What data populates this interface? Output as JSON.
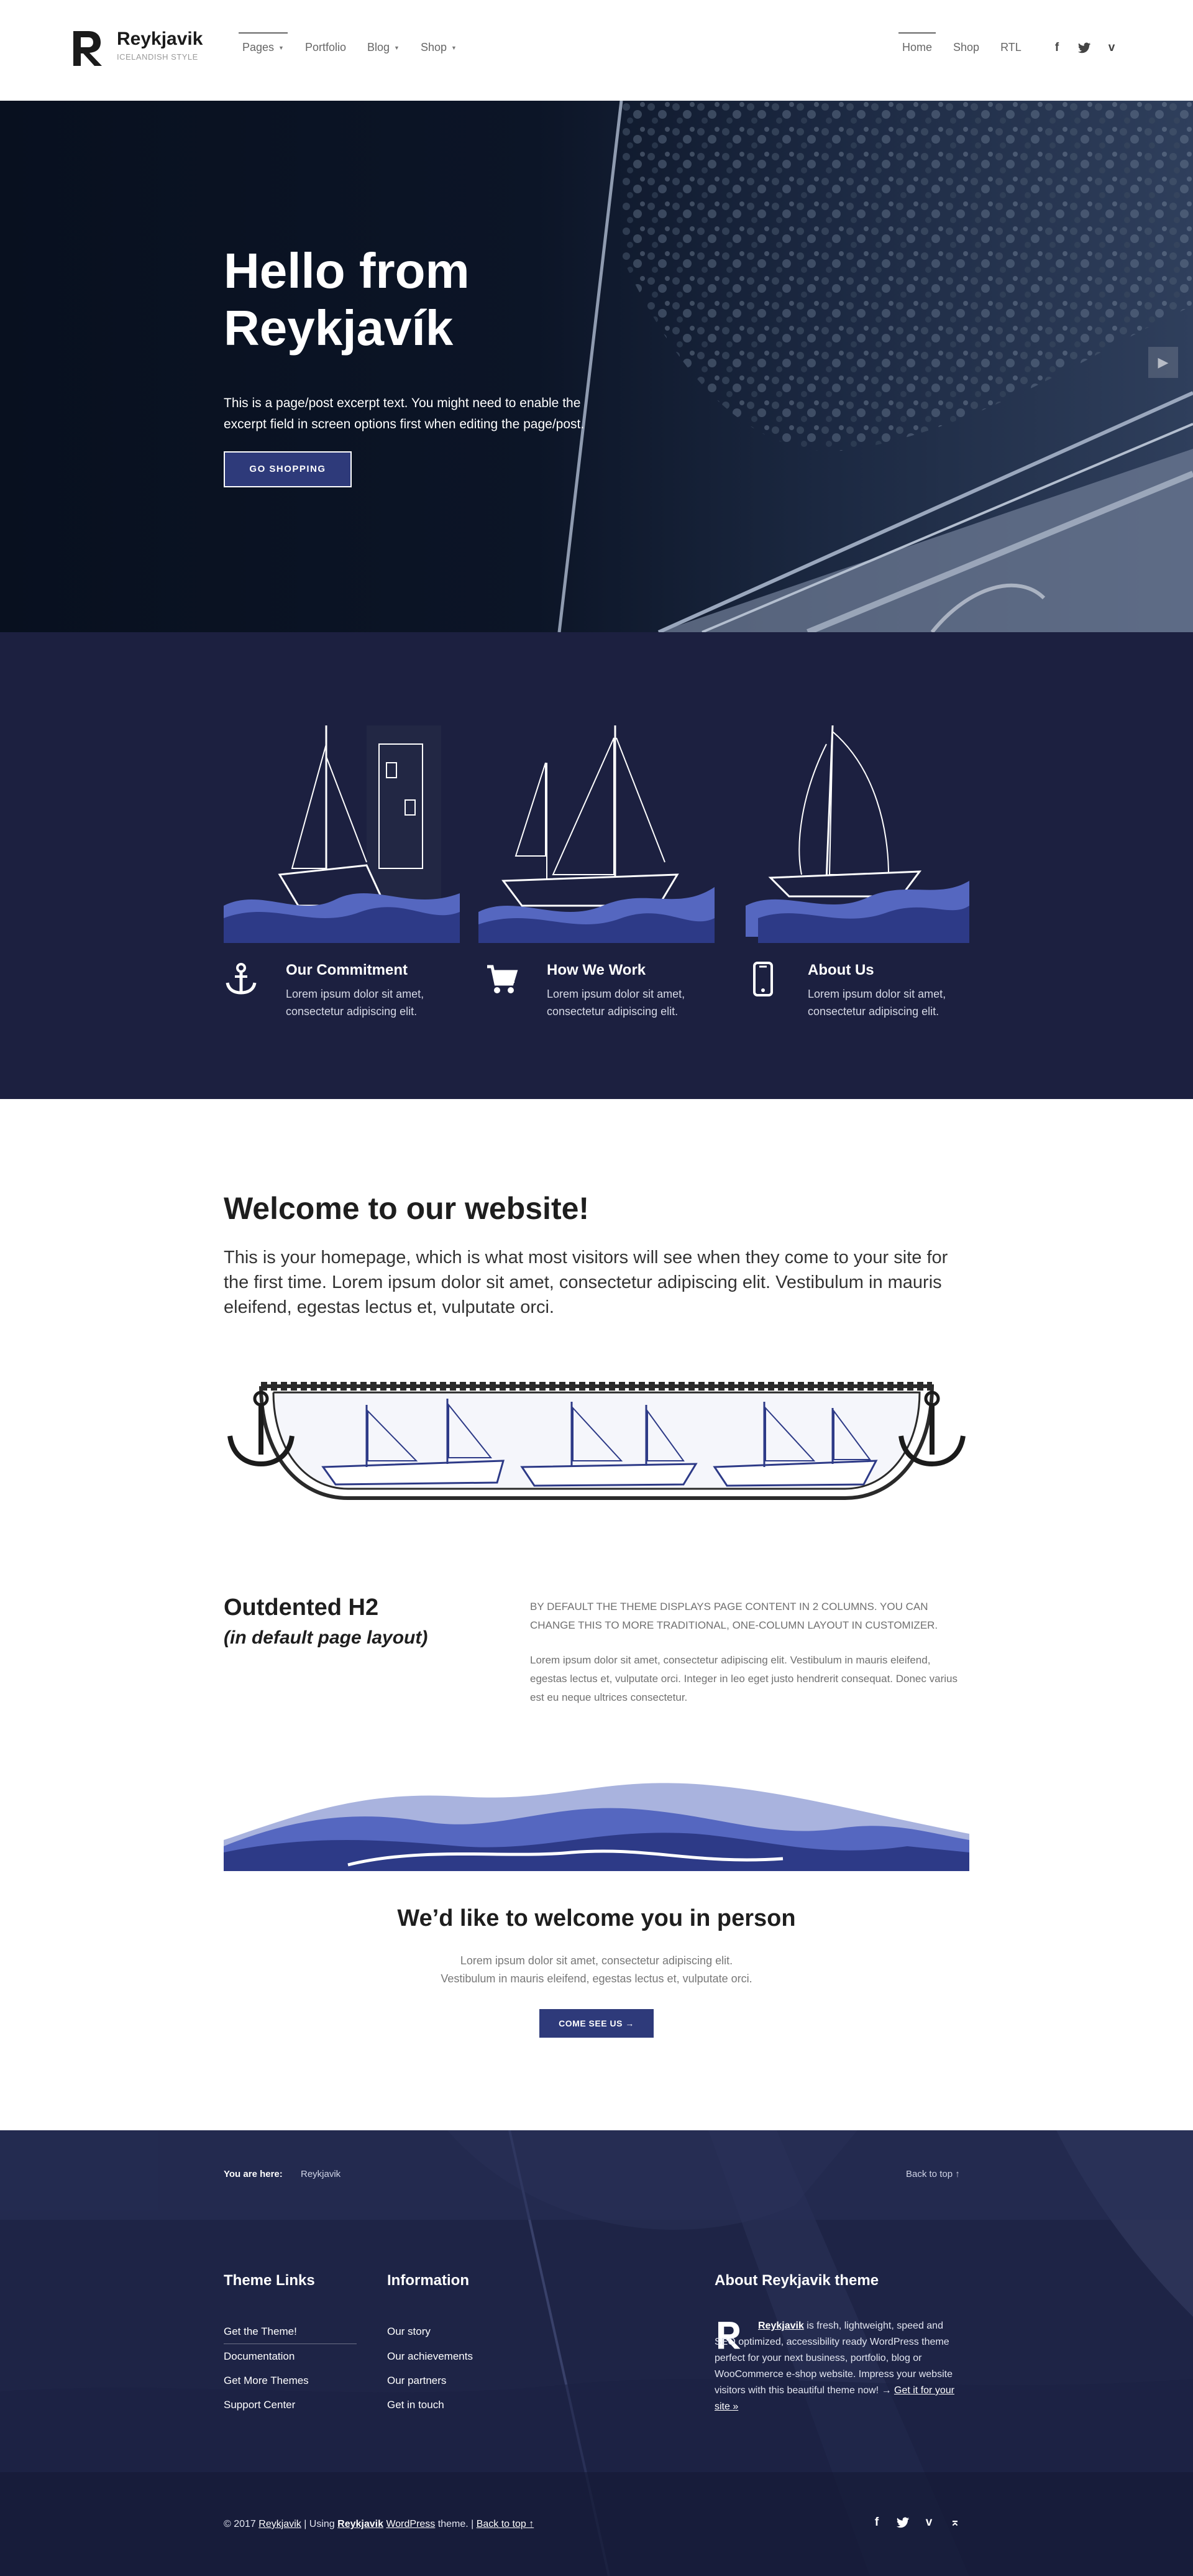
{
  "header": {
    "logo_name": "Reykjavik",
    "logo_tagline": "ICELANDISH STYLE",
    "nav_left": [
      {
        "label": "Pages",
        "has_caret": true
      },
      {
        "label": "Portfolio",
        "has_caret": false
      },
      {
        "label": "Blog",
        "has_caret": true
      },
      {
        "label": "Shop",
        "has_caret": true
      }
    ],
    "nav_right": [
      {
        "label": "Home"
      },
      {
        "label": "Shop"
      },
      {
        "label": "RTL"
      }
    ],
    "socials": [
      "facebook-icon",
      "twitter-icon",
      "vimeo-icon"
    ]
  },
  "hero": {
    "title": "Hello from Reykjavík",
    "excerpt": "This is a page/post excerpt text. You might need to enable the excerpt field in screen options first when editing the page/post.",
    "button": "GO SHOPPING"
  },
  "features": [
    {
      "icon": "anchor-icon",
      "title": "Our Commitment",
      "text": "Lorem ipsum dolor sit amet, consectetur adipiscing elit."
    },
    {
      "icon": "cart-icon",
      "title": "How We Work",
      "text": "Lorem ipsum dolor sit amet, consectetur adipiscing elit."
    },
    {
      "icon": "phone-icon",
      "title": "About Us",
      "text": "Lorem ipsum dolor sit amet, consectetur adipiscing elit."
    }
  ],
  "welcome": {
    "title": "Welcome to our website!",
    "text": "This is your homepage, which is what most visitors will see when they come to your site for the first time. Lorem ipsum dolor sit amet, consectetur adipiscing elit. Vestibulum in mauris eleifend, egestas lectus et, vulputate orci."
  },
  "outdented": {
    "title": "Outdented H2",
    "subtitle": "(in default page layout)",
    "caps_text": "By default the theme displays page content in 2 columns. You can change this to more traditional, one-column layout in customizer.",
    "paragraph": "Lorem ipsum dolor sit amet, consectetur adipiscing elit. Vestibulum in mauris eleifend, egestas lectus et, vulputate orci. Integer in leo eget justo hendrerit consequat. Donec varius est eu neque ultrices consectetur."
  },
  "person": {
    "title": "We’d like to welcome you in person",
    "line1": "Lorem ipsum dolor sit amet, consectetur adipiscing elit.",
    "line2": "Vestibulum in mauris eleifend, egestas lectus et, vulputate orci.",
    "button": "COME SEE US →"
  },
  "footer": {
    "breadcrumb_label": "You are here:",
    "breadcrumb_item": "Reykjavik",
    "back_to_top": "Back to top ↑",
    "theme_links_title": "Theme Links",
    "theme_links": [
      "Get the Theme!",
      "Documentation",
      "Get More Themes",
      "Support Center"
    ],
    "info_title": "Information",
    "info_links": [
      "Our story",
      "Our achievements",
      "Our partners",
      "Get in touch"
    ],
    "about_title": "About Reykjavik theme",
    "about_brand": "Reykjavik",
    "about_text": " is fresh, lightweight, speed and SEO optimized, accessibility ready WordPress theme perfect for your next business, portfolio, blog or WooCommerce e-shop website. Impress your website visitors with this beautiful theme now! → ",
    "about_link": "Get it for your site »",
    "copyright_prefix": "© 2017 ",
    "copyright_site": "Reykjavik",
    "copyright_mid1": " | Using ",
    "copyright_theme": "Reykjavik",
    "copyright_wp": "WordPress",
    "copyright_mid2": " theme. | ",
    "copyright_back": "Back to top ↑",
    "socials": [
      "facebook-icon",
      "twitter-icon",
      "vimeo-icon",
      "back-to-top-icon"
    ]
  },
  "colors": {
    "accent": "#2e3a7a",
    "features_bg": "#1c2040",
    "footer_bg": "#1e2446",
    "wave_dark": "#2d3a87",
    "wave_mid": "#5567c0",
    "wave_light": "#a9b3de"
  }
}
